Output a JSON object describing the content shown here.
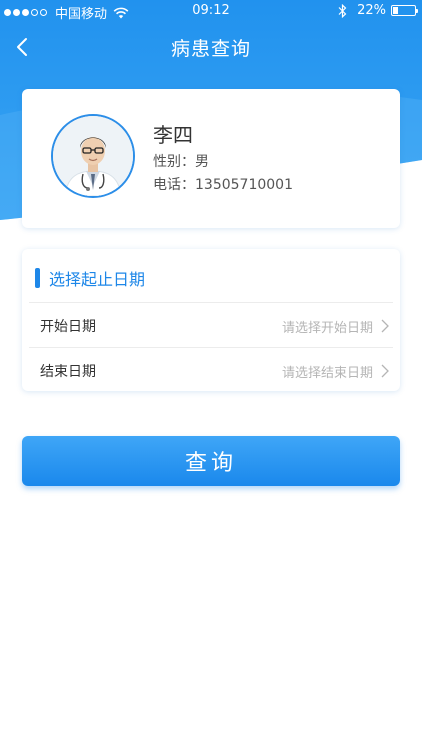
{
  "status_bar": {
    "carrier": "中国移动",
    "time": "09:12",
    "battery_percent": "22%",
    "battery_level": 0.22,
    "signal_bars_filled": 3,
    "signal_bars_total": 5
  },
  "nav": {
    "back_icon": "chevron-left-icon",
    "title": "病患查询"
  },
  "patient": {
    "name": "李四",
    "gender_label": "性别：",
    "gender": "男",
    "phone_label": "电话：",
    "phone": "13505710001",
    "avatar_icon": "doctor-avatar"
  },
  "date_section": {
    "title": "选择起止日期",
    "start": {
      "label": "开始日期",
      "placeholder": "请选择开始日期"
    },
    "end": {
      "label": "结束日期",
      "placeholder": "请选择结束日期"
    }
  },
  "actions": {
    "query_label": "查询"
  },
  "colors": {
    "primary": "#1e87e8",
    "header_top": "#2192ee",
    "placeholder": "#b5b5b5"
  }
}
